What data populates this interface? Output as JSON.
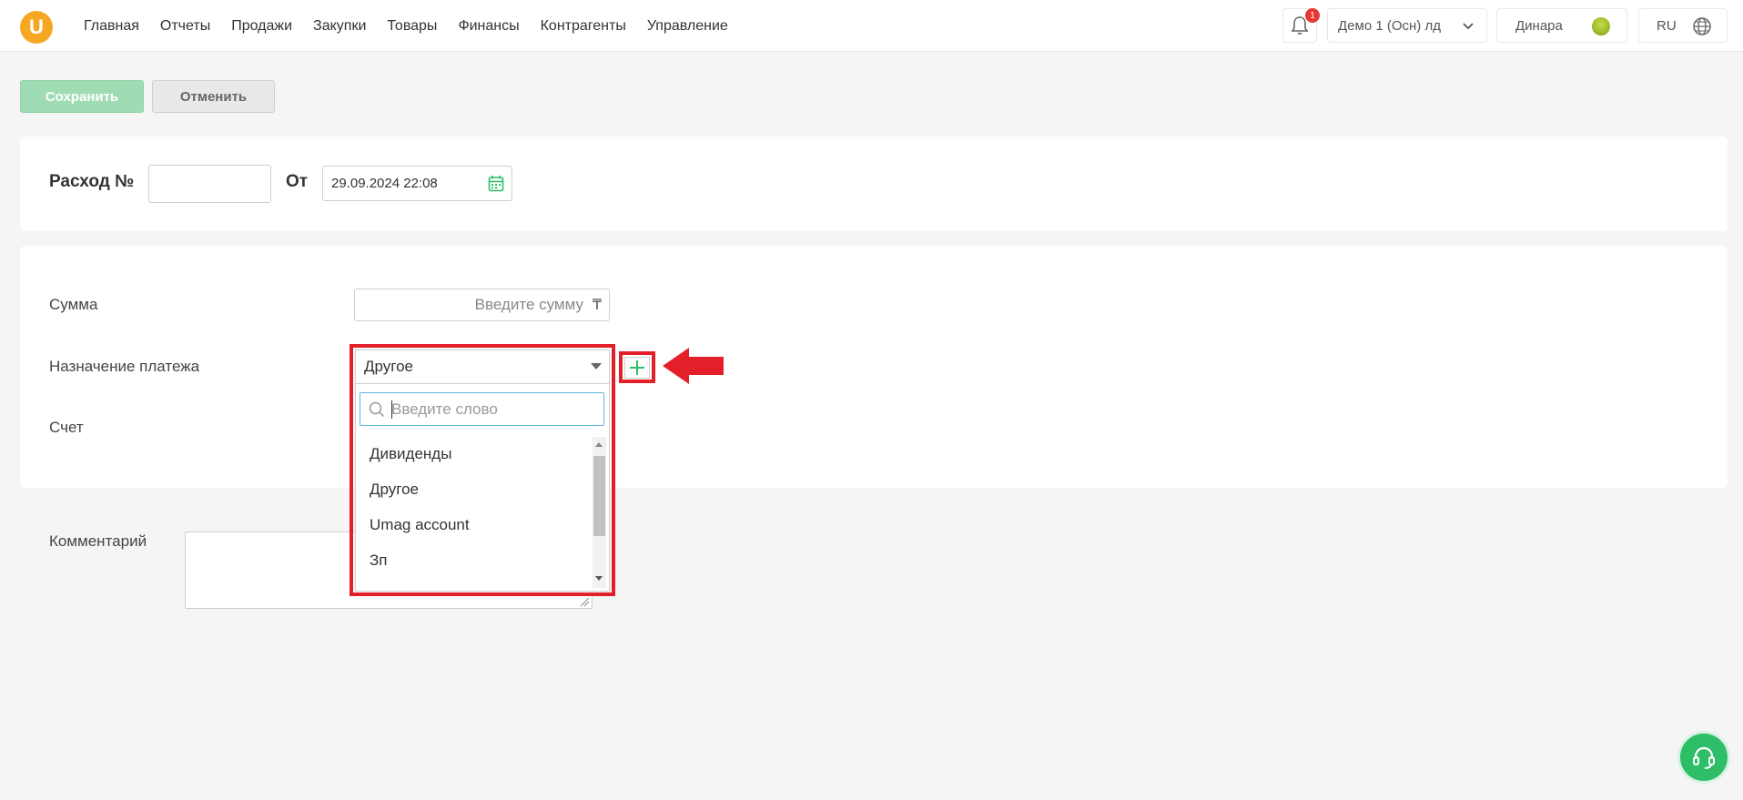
{
  "nav": {
    "logo_letter": "U",
    "items": [
      "Главная",
      "Отчеты",
      "Продажи",
      "Закупки",
      "Товары",
      "Финансы",
      "Контрагенты",
      "Управление"
    ]
  },
  "header": {
    "notification_count": "1",
    "store": "Демо 1 (Осн) лд",
    "user": "Динара",
    "language": "RU"
  },
  "toolbar": {
    "save_label": "Сохранить",
    "cancel_label": "Отменить"
  },
  "doc": {
    "title_label": "Расход №",
    "number": "",
    "from_label": "От",
    "date": "29.09.2024 22:08"
  },
  "form": {
    "sum_label": "Сумма",
    "sum_placeholder": "Введите сумму",
    "currency_symbol": "₸",
    "purpose_label": "Назначение платежа",
    "purpose_value": "Другое",
    "account_label": "Счет",
    "comment_label": "Комментарий",
    "search_placeholder": "Введите слово",
    "options": [
      "Дивиденды",
      "Другое",
      "Umag account",
      "Зп"
    ]
  },
  "colors": {
    "accent_green": "#2fbe68",
    "save_button": "#9fdcb3",
    "highlight_red": "#e3202a",
    "logo_orange": "#f7a823"
  }
}
